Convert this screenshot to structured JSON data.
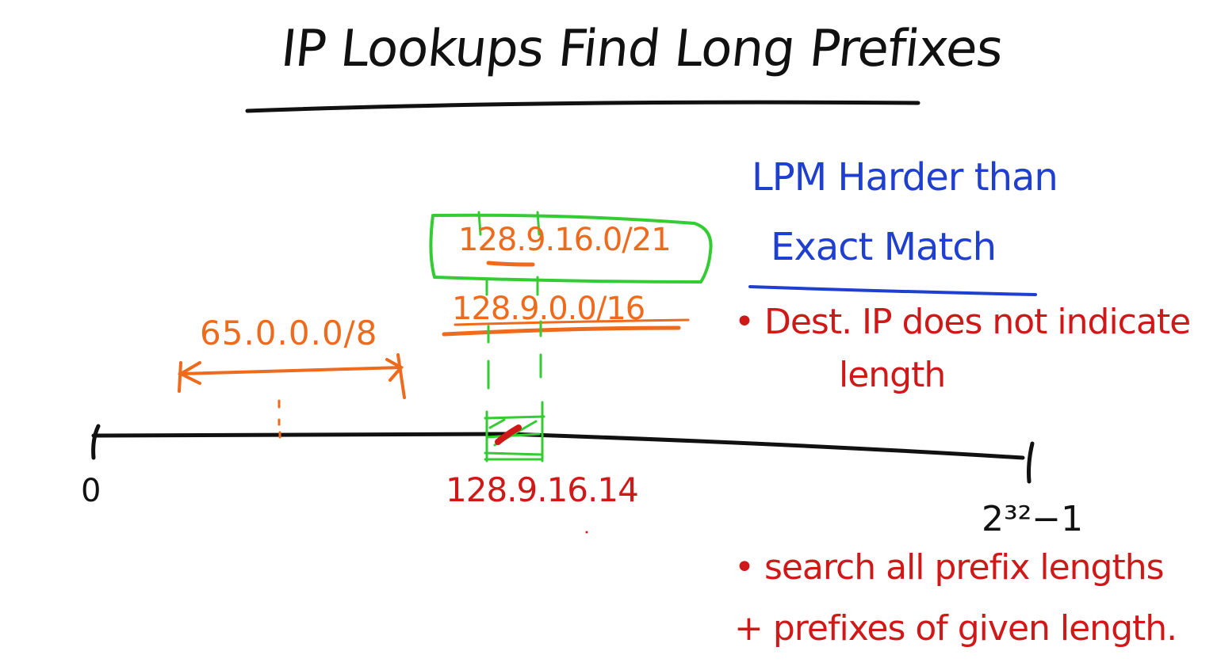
{
  "title": "IP Lookups Find Long Prefixes",
  "side_note": {
    "heading_line1": "LPM Harder than",
    "heading_line2": "Exact Match",
    "bullet1_line1": "• Dest. IP does not indicate",
    "bullet1_line2": "length",
    "bullet2_line1": "• search all prefix lengths",
    "bullet2_line2": "+ prefixes of given length."
  },
  "prefixes": {
    "p21": "128.9.16.0/21",
    "p16": "128.9.0.0/16",
    "p8": "65.0.0.0/8"
  },
  "address_line": {
    "start_label": "0",
    "end_label": "2³²−1",
    "dest_address": "128.9.16.14"
  },
  "colors": {
    "ink_black": "#111111",
    "ink_blue": "#1f3fd0",
    "ink_red": "#d01818",
    "ink_orange": "#ee6a1c",
    "ink_green": "#33cc33"
  }
}
